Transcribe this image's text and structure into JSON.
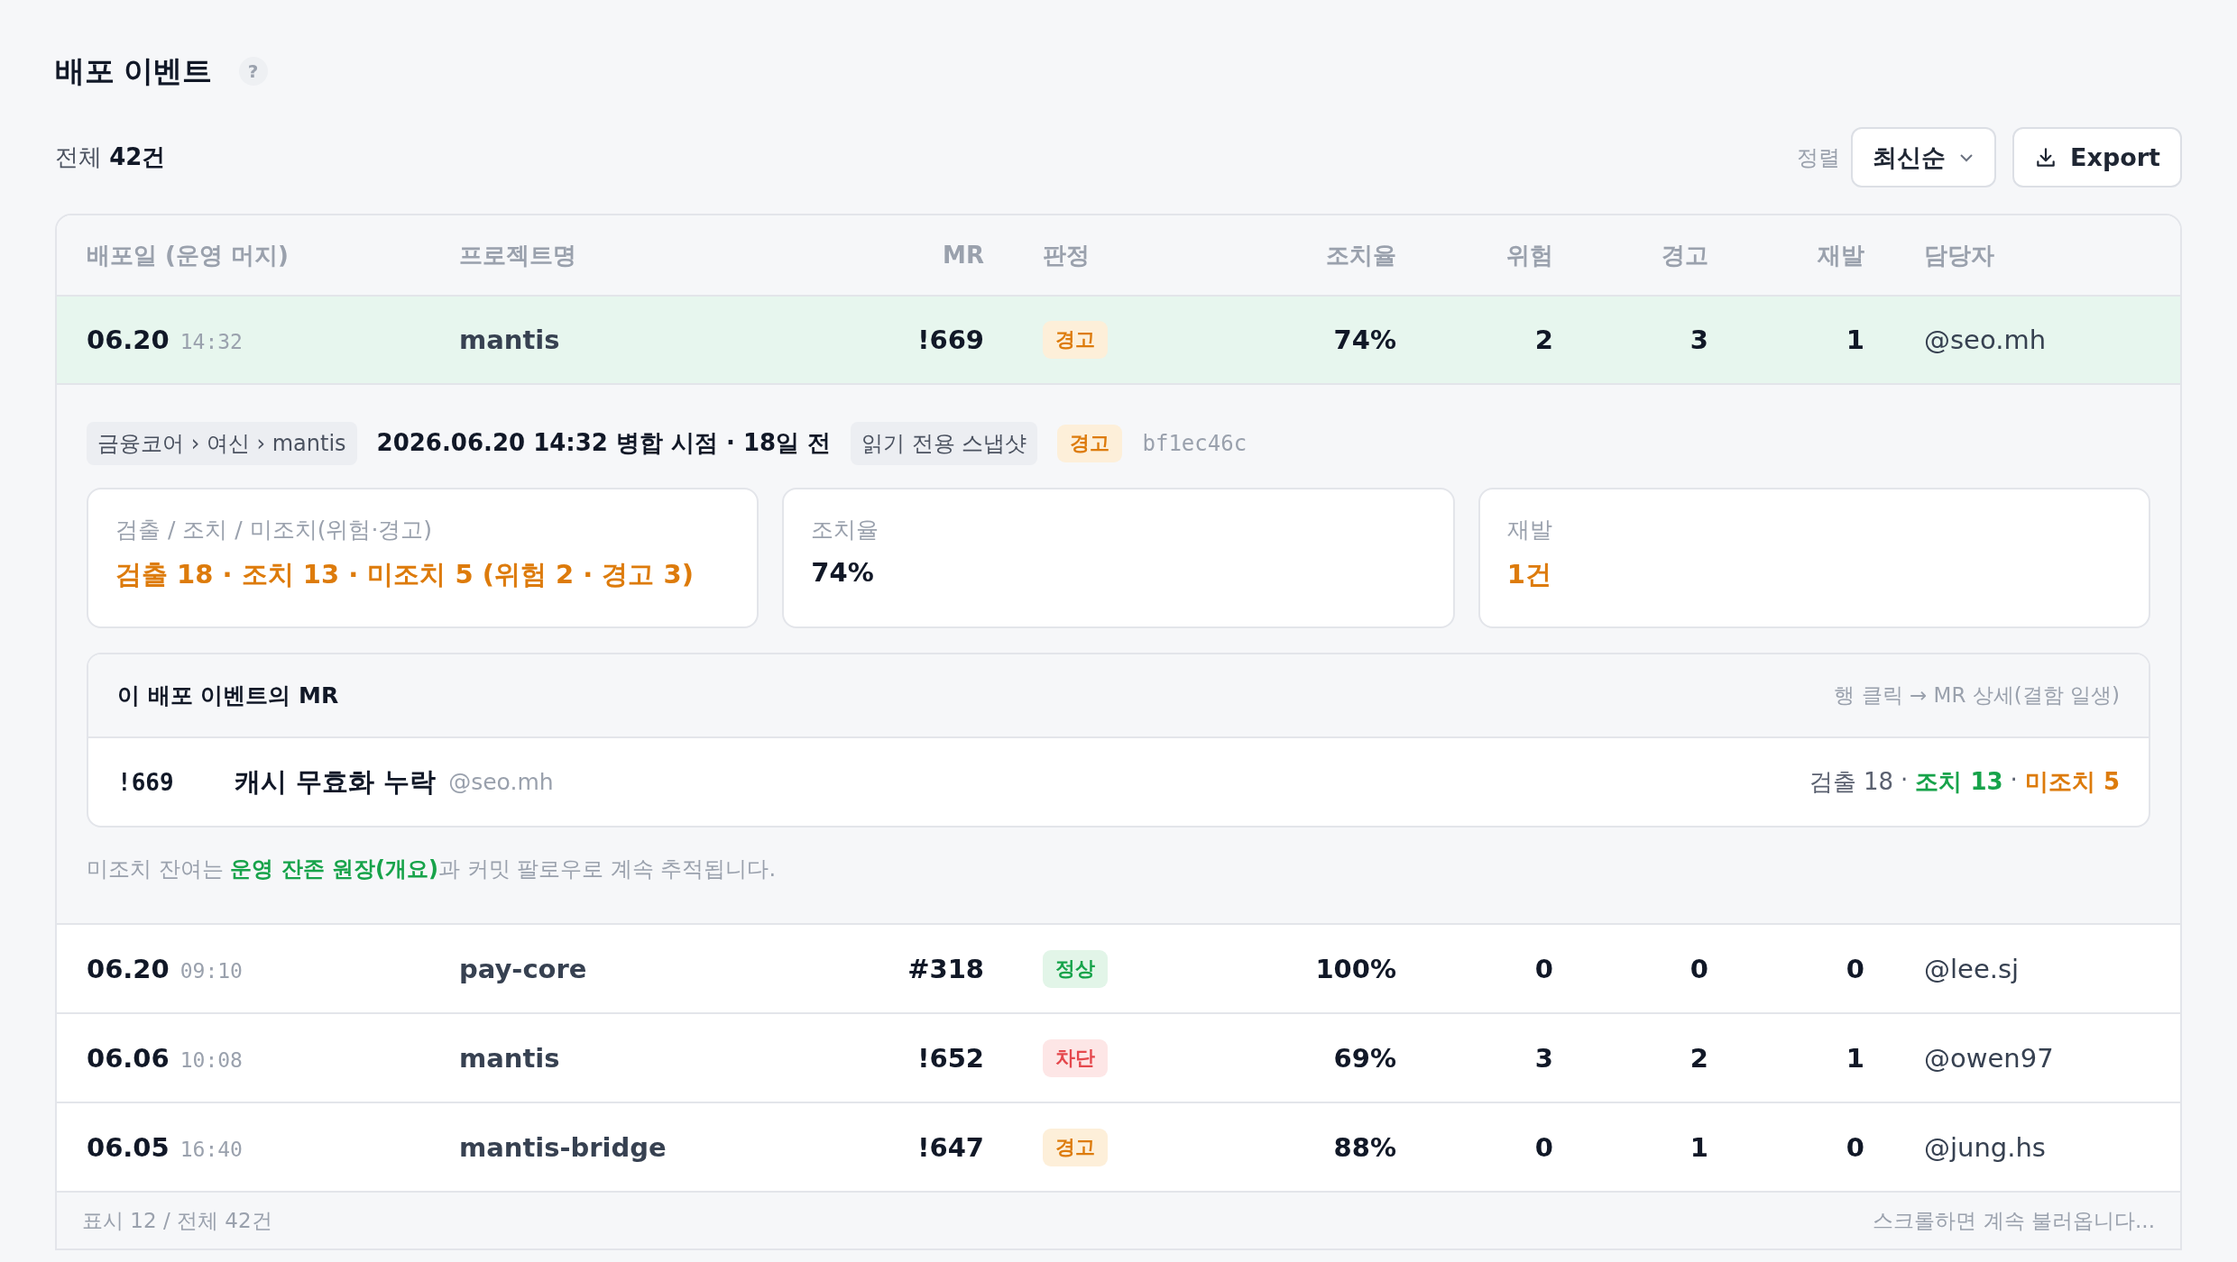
{
  "page": {
    "title": "배포 이벤트",
    "help_icon": "?"
  },
  "summary": "전체 **42건**",
  "sort": {
    "label": "정렬",
    "value": "최신순"
  },
  "export_button": "Export",
  "table": {
    "columns": [
      "배포일 (운영 머지)",
      "프로젝트명",
      "MR",
      "판정",
      "조치율",
      "위험",
      "경고",
      "재발",
      "담당자"
    ],
    "rows": [
      {
        "date": "06.20",
        "time": "14:32",
        "project": "mantis",
        "mr": "!669",
        "verdict": {
          "label": "경고",
          "kind": "warning"
        },
        "rate": "74%",
        "risk": "2",
        "warn": "3",
        "recur": "1",
        "owner": "@seo.mh",
        "selected": true,
        "expanded": true
      },
      {
        "date": "06.20",
        "time": "09:10",
        "project": "pay-core",
        "mr": "#318",
        "verdict": {
          "label": "정상",
          "kind": "ok"
        },
        "rate": "100%",
        "risk": "0",
        "warn": "0",
        "recur": "0",
        "owner": "@lee.sj",
        "selected": false,
        "expanded": false
      },
      {
        "date": "06.06",
        "time": "10:08",
        "project": "mantis",
        "mr": "!652",
        "verdict": {
          "label": "차단",
          "kind": "blocked"
        },
        "rate": "69%",
        "risk": "3",
        "warn": "2",
        "recur": "1",
        "owner": "@owen97",
        "selected": false,
        "expanded": false
      },
      {
        "date": "06.05",
        "time": "16:40",
        "project": "mantis-bridge",
        "mr": "!647",
        "verdict": {
          "label": "경고",
          "kind": "warning"
        },
        "rate": "88%",
        "risk": "0",
        "warn": "1",
        "recur": "0",
        "owner": "@jung.hs",
        "selected": false,
        "expanded": false
      }
    ],
    "footer": {
      "shown": "표시 12 / 전체 42건",
      "hint": "스크롤하면 계속 불러옵니다..."
    }
  },
  "detail": {
    "breadcrumb": "금융코어 › 여신 › mantis",
    "merged": "2026.06.20 14:32 병합 시점 · 18일 전",
    "snapshot": "읽기 전용 스냅샷",
    "verdict": {
      "label": "경고",
      "kind": "warning"
    },
    "commit": "bf1ec46c",
    "cards": [
      {
        "label": "검출 / 조치 / 미조치(위험·경고)",
        "value": "검출 18 · 조치 13 · 미조치 5 (위험 2 · 경고 3)",
        "color": "#dd7b0b"
      },
      {
        "label": "조치율",
        "value": "74%",
        "color": "#111827"
      },
      {
        "label": "재발",
        "value": "1건",
        "color": "#dd7b0b"
      }
    ],
    "mr_panel": {
      "title": "이 배포 이벤트의 MR",
      "hint": "행 클릭 → MR 상세(결함 일생)",
      "rows": [
        {
          "mr": "!669",
          "title": "캐시 무효화 누락",
          "owner": "@seo.mh",
          "stats": [
            {
              "text": "검출 18",
              "color": "#5b6170"
            },
            {
              "text": "·",
              "color": "#5b6170"
            },
            {
              "text": "조치 13",
              "color": "#17a34a"
            },
            {
              "text": "·",
              "color": "#5b6170"
            },
            {
              "text": "미조치 5",
              "color": "#dd7b0b"
            }
          ]
        }
      ]
    },
    "note": {
      "before": "미조치 잔여는 ",
      "link": "운영 잔존 원장(개요)",
      "after": "과 커밋 팔로우로 계속 추적됩니다."
    }
  }
}
